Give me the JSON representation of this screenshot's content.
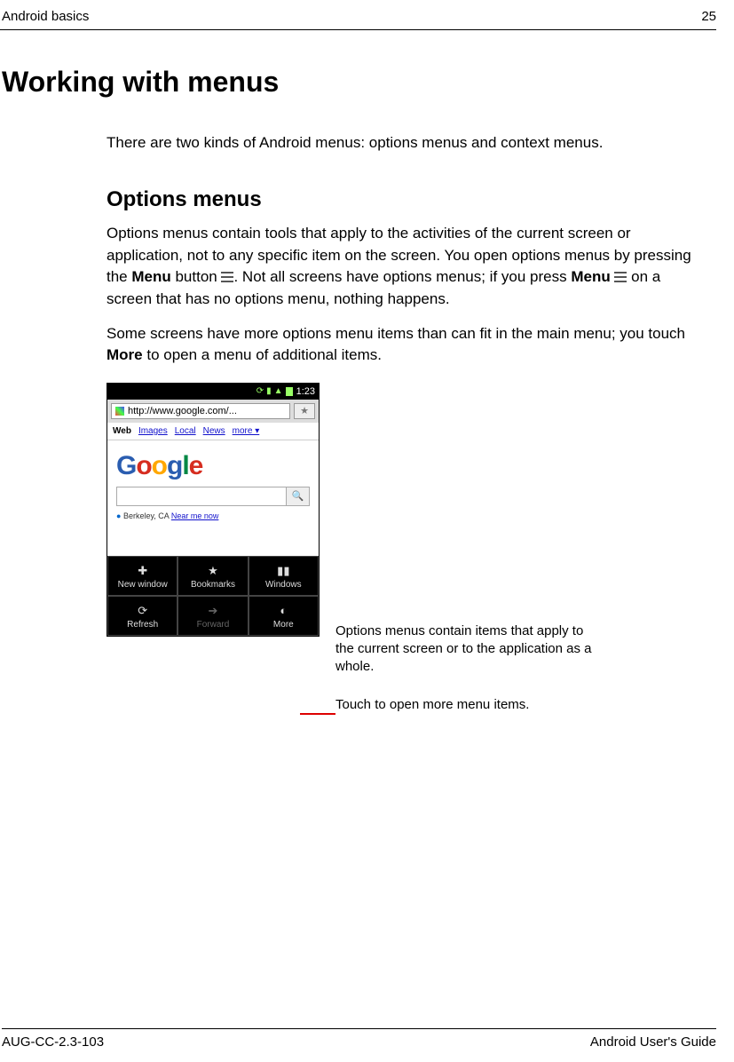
{
  "header": {
    "chapter": "Android basics",
    "page_number": "25"
  },
  "title": "Working with menus",
  "intro": "There are two kinds of Android menus: options menus and context menus.",
  "section_heading": "Options menus",
  "para1_a": "Options menus contain tools that apply to the activities of the current screen or application, not to any specific item on the screen. You open options menus by pressing the ",
  "para1_b": "Menu",
  "para1_c": " button ",
  "para1_d": ". Not all screens have options menus; if you press ",
  "para1_e": "Menu",
  "para1_f": " on a screen that has no options menu, nothing happens.",
  "para2_a": "Some screens have more options menu items than can fit in the main menu; you touch ",
  "para2_b": "More",
  "para2_c": " to open a menu of additional items.",
  "phone": {
    "status_time": "1:23",
    "url": "http://www.google.com/...",
    "tabs": {
      "web": "Web",
      "images": "Images",
      "local": "Local",
      "news": "News",
      "more": "more ▾"
    },
    "location_label": "Berkeley, CA",
    "near_me": "Near me now",
    "menu": {
      "new_window": "New window",
      "bookmarks": "Bookmarks",
      "windows": "Windows",
      "refresh": "Refresh",
      "forward": "Forward",
      "more": "More"
    }
  },
  "callout1": "Options menus contain items that apply to the current screen or to the application as a whole.",
  "callout2": "Touch to open more menu items.",
  "footer": {
    "doc_id": "AUG-CC-2.3-103",
    "doc_name": "Android User's Guide"
  }
}
